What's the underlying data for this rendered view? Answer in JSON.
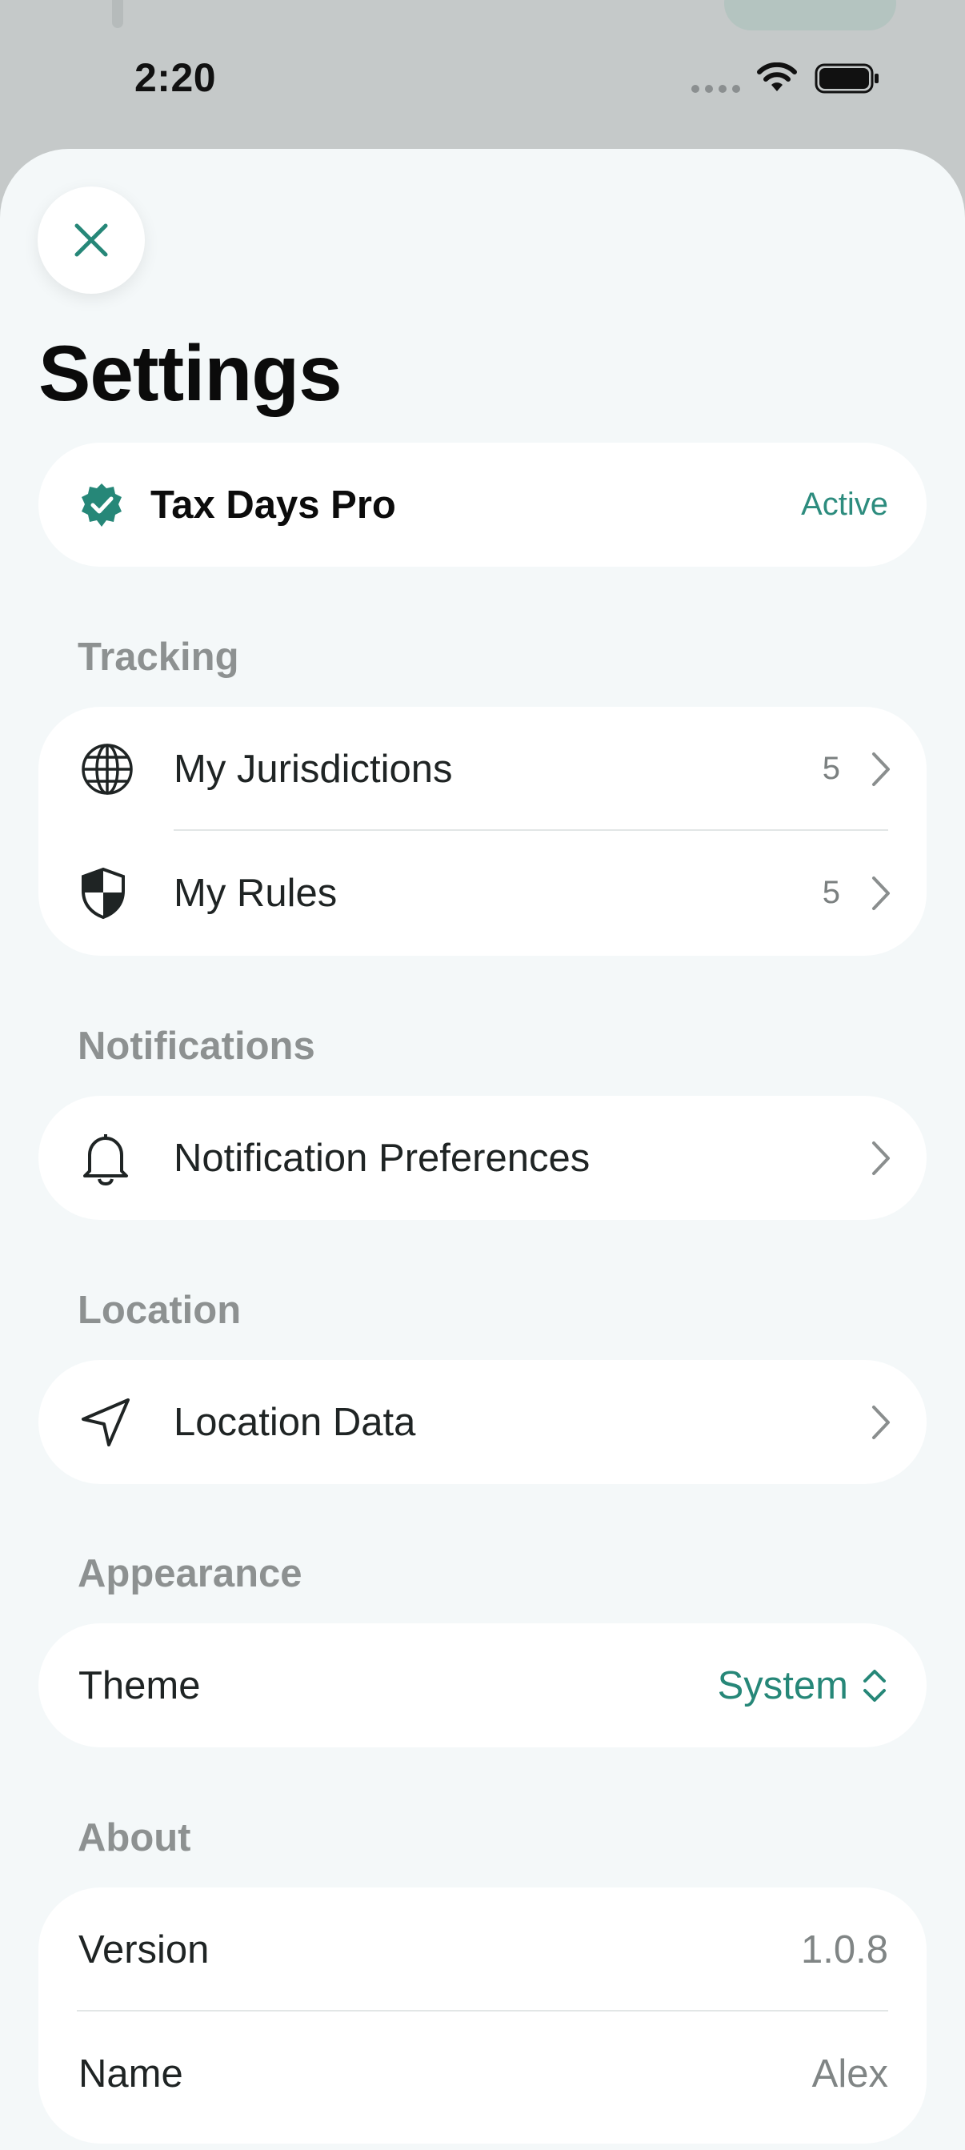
{
  "status_bar": {
    "time": "2:20"
  },
  "header": {
    "title": "Settings"
  },
  "subscription": {
    "name": "Tax Days Pro",
    "status": "Active"
  },
  "sections": {
    "tracking": {
      "label": "Tracking",
      "items": [
        {
          "label": "My Jurisdictions",
          "count": "5",
          "icon": "globe-icon"
        },
        {
          "label": "My Rules",
          "count": "5",
          "icon": "shield-icon"
        }
      ]
    },
    "notifications": {
      "label": "Notifications",
      "items": [
        {
          "label": "Notification Preferences",
          "icon": "bell-icon"
        }
      ]
    },
    "location": {
      "label": "Location",
      "items": [
        {
          "label": "Location Data",
          "icon": "location-arrow-icon"
        }
      ]
    },
    "appearance": {
      "label": "Appearance",
      "theme": {
        "label": "Theme",
        "value": "System"
      }
    },
    "about": {
      "label": "About",
      "items": [
        {
          "label": "Version",
          "value": "1.0.8"
        },
        {
          "label": "Name",
          "value": "Alex"
        }
      ]
    }
  },
  "colors": {
    "accent": "#268778",
    "sheet_background": "#f4f8f9",
    "card": "#ffffff"
  }
}
